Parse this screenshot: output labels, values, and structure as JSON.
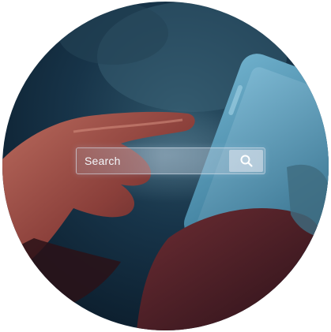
{
  "search": {
    "placeholder": "Search",
    "icon": "search-icon"
  },
  "colors": {
    "background_dark": "#0e2233",
    "phone_edge": "#5fa2c0",
    "skin_warm": "#9a4e44",
    "overlay_text": "#f3f6fa"
  }
}
